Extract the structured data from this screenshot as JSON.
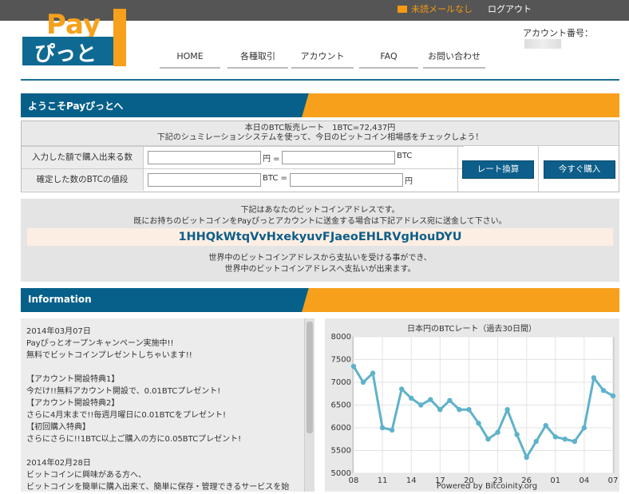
{
  "header": {
    "mail_text": "未読メールなし",
    "logout": "ログアウト",
    "account_label": "アカウント番号：",
    "logo_top": "Pay",
    "logo_bottom": "ぴっと"
  },
  "nav": [
    "HOME",
    "各種取引",
    "アカウント",
    "FAQ",
    "お問い合わせ"
  ],
  "welcome": {
    "title": "ようこそPayぴっとへ"
  },
  "calculator": {
    "rate_line": "本日のBTC販売レート　1BTC=72,437円",
    "sim_line": "下記のシュミレーションシステムを使って、今日のビットコイン相場感をチェックしよう！",
    "row1_label": "入力した額で購入出来る数",
    "row2_label": "確定した数のBTCの値段",
    "yen_eq": "円 =",
    "btc": "BTC",
    "btc_eq": "BTC =",
    "yen": "円",
    "convert_button": "レート換算",
    "buy_button": "今すぐ購入"
  },
  "address": {
    "line1": "下記はあなたのビットコインアドレスです。",
    "line2": "既にお持ちのビットコインをPayぴっとアカウントに送金する場合は下記アドレス宛に送金して下さい。",
    "code": "1HHQkWtqVvHxekyuvFJaeoEHLRVgHouDYU",
    "line3": "世界中のビットコインアドレスから支払いを受ける事ができ、",
    "line4": "世界中のビットコインアドレスへ支払いが出来ます。"
  },
  "information": {
    "title": "Information",
    "lines": [
      "2014年03月07日",
      "Payぴっとオープンキャンペーン実施中!!",
      "無料でビットコインプレゼントしちゃいます!!",
      "",
      "【アカウント開設特典1】",
      "今だけ!!無料アカウント開設で、0.01BTCプレゼント!",
      "【アカウント開設特典2】",
      "さらに4月末まで!!毎週月曜日に0.01BTCをプレゼント!",
      "【初回購入特典】",
      "さらにさらに!!1BTC以上ご購入の方に0.05BTCプレゼント!",
      "",
      "2014年02月28日",
      "ビットコインに興味がある方へ、",
      "ビットコインを簡単に購入出来て、簡単に保存・管理できるサービスを始"
    ]
  },
  "chart_data": {
    "type": "line",
    "title": "日本円のBTCレート（過去30日間）",
    "footer": "Powered by Bitcoinity.org",
    "ylim": [
      5000,
      8000
    ],
    "yticks": [
      "8000",
      "7500",
      "7000",
      "6500",
      "6000",
      "5500",
      "5000"
    ],
    "xticks": [
      "08",
      "11",
      "14",
      "17",
      "20",
      "23",
      "26",
      "01",
      "04",
      "07"
    ],
    "x": [
      "02-08",
      "02-09",
      "02-10",
      "02-11",
      "02-12",
      "02-13",
      "02-14",
      "02-15",
      "02-16",
      "02-17",
      "02-18",
      "02-19",
      "02-20",
      "02-21",
      "02-22",
      "02-23",
      "02-24",
      "02-25",
      "02-26",
      "02-27",
      "02-28",
      "03-01",
      "03-02",
      "03-03",
      "03-04",
      "03-05",
      "03-06",
      "03-07"
    ],
    "values": [
      7350,
      7000,
      7200,
      6000,
      5950,
      6850,
      6650,
      6500,
      6620,
      6400,
      6600,
      6400,
      6400,
      6100,
      5750,
      5900,
      6400,
      5850,
      5350,
      5700,
      6050,
      5800,
      5750,
      5700,
      6000,
      7100,
      6820,
      6700
    ],
    "color": "#5fb2ca",
    "grid": true
  }
}
